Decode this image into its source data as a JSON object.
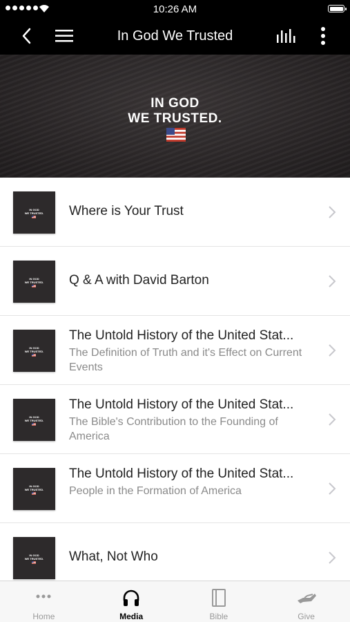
{
  "status": {
    "time": "10:26 AM"
  },
  "nav": {
    "title": "In God We Trusted",
    "icons": [
      "back-chevron-icon",
      "hamburger-menu-icon",
      "audio-bars-icon",
      "more-vertical-icon"
    ]
  },
  "hero": {
    "line1": "IN GOD",
    "line2": "WE TRUSTED."
  },
  "thumb_text": {
    "line1": "IN GOD",
    "line2": "WE TRUSTED."
  },
  "items": [
    {
      "title": "Where is Your Trust",
      "subtitle": ""
    },
    {
      "title": "Q & A with David Barton",
      "subtitle": ""
    },
    {
      "title": "The Untold History of the United Stat...",
      "subtitle": "The Definition of Truth and it's Effect on Current Events"
    },
    {
      "title": "The Untold History of the United Stat...",
      "subtitle": "The Bible's Contribution to the Founding of America"
    },
    {
      "title": "The Untold History of the United Stat...",
      "subtitle": "People in the Formation of America"
    },
    {
      "title": "What, Not Who",
      "subtitle": ""
    }
  ],
  "tabs": [
    {
      "label": "Home",
      "icon": "ellipsis-icon",
      "active": false
    },
    {
      "label": "Media",
      "icon": "headphones-icon",
      "active": true
    },
    {
      "label": "Bible",
      "icon": "book-icon",
      "active": false
    },
    {
      "label": "Give",
      "icon": "giving-hand-icon",
      "active": false
    }
  ],
  "colors": {
    "navbar": "#000000",
    "hero_bg": "#2a2627",
    "tab_active": "#000000",
    "tab_inactive": "#999999"
  }
}
